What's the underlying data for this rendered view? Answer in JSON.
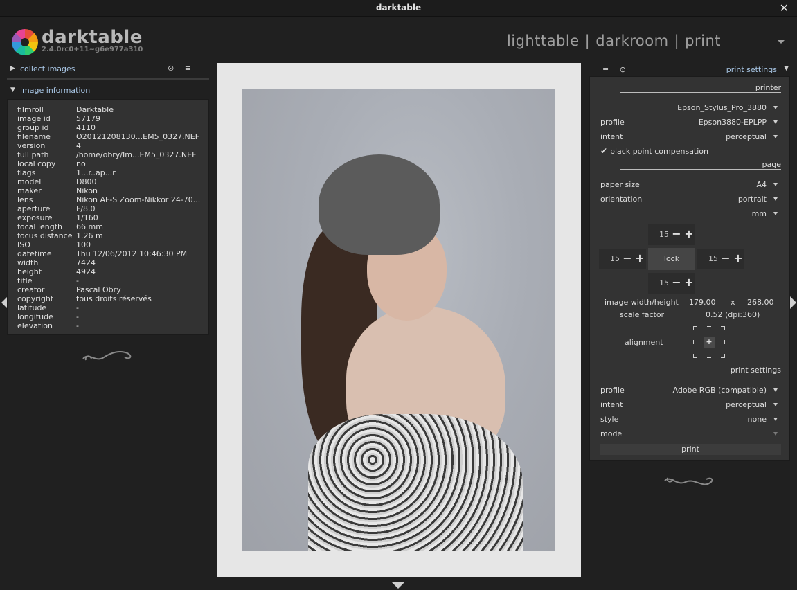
{
  "window": {
    "title": "darktable",
    "close_label": "✕"
  },
  "header": {
    "app_name": "darktable",
    "version": "2.4.0rc0+11~g6e977a310",
    "views": [
      "lighttable",
      "darkroom",
      "print"
    ],
    "separator": "|"
  },
  "left": {
    "collect": {
      "label": "collect images",
      "icons": "⊙ ≡",
      "arrow": "▶"
    },
    "info": {
      "label": "image information",
      "arrow": "▼"
    },
    "info_rows": [
      {
        "k": "filmroll",
        "v": "Darktable"
      },
      {
        "k": "image id",
        "v": "57179"
      },
      {
        "k": "group id",
        "v": "4110"
      },
      {
        "k": "filename",
        "v": "O20121208130...EM5_0327.NEF"
      },
      {
        "k": "version",
        "v": "4"
      },
      {
        "k": "full path",
        "v": "/home/obry/Im...EM5_0327.NEF"
      },
      {
        "k": "local copy",
        "v": "no"
      },
      {
        "k": "flags",
        "v": "1...r..ap...r"
      },
      {
        "k": "model",
        "v": "D800"
      },
      {
        "k": "maker",
        "v": "Nikon"
      },
      {
        "k": "lens",
        "v": "Nikon AF-S Zoom-Nikkor 24-70..."
      },
      {
        "k": "aperture",
        "v": "F/8.0"
      },
      {
        "k": "exposure",
        "v": "1/160"
      },
      {
        "k": "focal length",
        "v": "66 mm"
      },
      {
        "k": "focus distance",
        "v": "1.26 m"
      },
      {
        "k": "ISO",
        "v": "100"
      },
      {
        "k": "datetime",
        "v": "Thu 12/06/2012 10:46:30 PM"
      },
      {
        "k": "width",
        "v": "7424"
      },
      {
        "k": "height",
        "v": "4924"
      },
      {
        "k": "title",
        "v": "-"
      },
      {
        "k": "creator",
        "v": "Pascal Obry"
      },
      {
        "k": "copyright",
        "v": "tous droits réservés"
      },
      {
        "k": "latitude",
        "v": "-"
      },
      {
        "k": "longitude",
        "v": "-"
      },
      {
        "k": "elevation",
        "v": "-"
      }
    ]
  },
  "right": {
    "header": {
      "label": "print settings",
      "icons": "≡ ⊙",
      "arrow": "▼"
    },
    "printer_section": "printer",
    "printer_name": "Epson_Stylus_Pro_3880",
    "profile_label": "profile",
    "profile_value": "Epson3880-EPLPP",
    "intent_label": "intent",
    "intent_value": "perceptual",
    "bpc_label": "black point compensation",
    "bpc_check": "✔",
    "page_section": "page",
    "paper_label": "paper size",
    "paper_value": "A4",
    "orientation_label": "orientation",
    "orientation_value": "portrait",
    "units_value": "mm",
    "margins": {
      "top": "15",
      "left": "15",
      "right": "15",
      "bottom": "15",
      "minus": "−",
      "plus": "+"
    },
    "lock_label": "lock",
    "image_size_label": "image width/height",
    "image_width": "179.00",
    "image_x": "x",
    "image_height": "268.00",
    "scale_label": "scale factor",
    "scale_value": "0.52 (dpi:360)",
    "alignment_label": "alignment",
    "alignment_center": "+",
    "print_section": "print settings",
    "p_profile_label": "profile",
    "p_profile_value": "Adobe RGB (compatible)",
    "p_intent_label": "intent",
    "p_intent_value": "perceptual",
    "style_label": "style",
    "style_value": "none",
    "mode_label": "mode",
    "print_button": "print"
  }
}
